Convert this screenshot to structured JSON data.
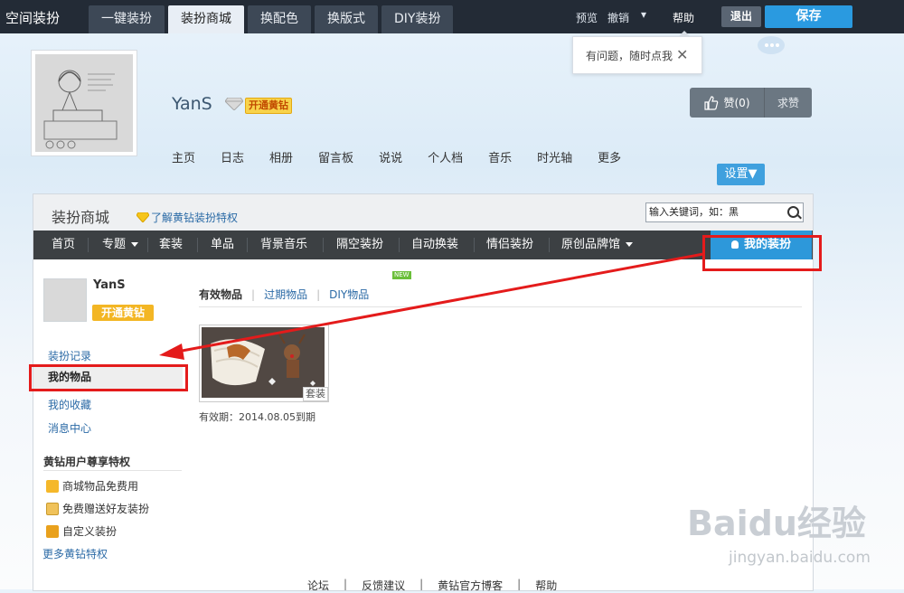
{
  "topbar": {
    "app_title": "空间装扮",
    "tabs": [
      "一键装扮",
      "装扮商城",
      "换配色",
      "换版式",
      "DIY装扮"
    ],
    "preview": "预览",
    "undo": "撤销",
    "help": "帮助",
    "exit": "退出",
    "save": "保存"
  },
  "help_tip": {
    "text": "有问题，随时点我",
    "close": "✕"
  },
  "profile": {
    "username": "YanS",
    "vip_badge": "开通黄钻",
    "like": "赞(0)",
    "visit": "求赞",
    "nav": [
      "主页",
      "日志",
      "相册",
      "留言板",
      "说说",
      "个人档",
      "音乐",
      "时光轴",
      "更多"
    ],
    "settings": "设置▼"
  },
  "mall": {
    "title": "装扮商城",
    "privilege_link": "了解黄钻装扮特权",
    "search_value": "输入关键词，如：黑",
    "nav": [
      "首页",
      "专题",
      "套装",
      "单品",
      "背景音乐",
      "隔空装扮",
      "自动换装",
      "情侣装扮",
      "原创品牌馆"
    ],
    "new_badge": "NEW",
    "my_dress": "我的装扮",
    "sidebar": {
      "username": "YanS",
      "vip_button": "开通黄钻",
      "links": [
        "装扮记录",
        "我的物品",
        "我的收藏",
        "消息中心"
      ],
      "privilege_title": "黄钻用户尊享特权",
      "privileges": [
        "商城物品免费用",
        "免费赠送好友装扮",
        "自定义装扮"
      ],
      "more": "更多黄钻特权"
    },
    "content": {
      "tabs": [
        "有效物品",
        "过期物品",
        "DIY物品"
      ],
      "item_tag": "套装",
      "item_expiry": "有效期：2014.08.05到期"
    },
    "footer": [
      "论坛",
      "反馈建议",
      "黄钻官方博客",
      "帮助"
    ]
  },
  "watermark": {
    "brand": "Baidu经验",
    "url": "jingyan.baidu.com"
  }
}
